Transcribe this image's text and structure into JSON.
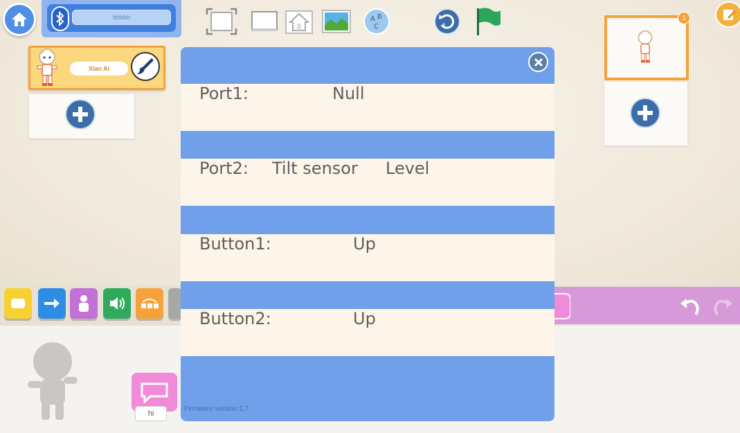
{
  "bluetooth": {
    "device_name": "bbbbb"
  },
  "sprite": {
    "name": "Xiao Ai"
  },
  "scene": {
    "badge": "1"
  },
  "script": {
    "speech_text": "hi"
  },
  "dialog": {
    "rows": [
      {
        "label": "Port1:",
        "value": "Null",
        "extra": ""
      },
      {
        "label": "Port2:",
        "value": "Tilt sensor",
        "extra": "Level"
      },
      {
        "label": "Button1:",
        "value": "Up",
        "extra": ""
      },
      {
        "label": "Button2:",
        "value": "Up",
        "extra": ""
      }
    ],
    "firmware": "Firmware version:1.7"
  },
  "colors": {
    "dialog_blue": "#6fa0e9",
    "row_cream": "#fdf5ea",
    "accent_orange": "#f3a23b",
    "bt_blue": "#3f7fe0"
  },
  "icons": [
    "home-icon",
    "bluetooth-icon",
    "fullscreen-icon",
    "window-icon",
    "house-outline-icon",
    "image-icon",
    "abc-icon",
    "reset-icon",
    "green-flag-icon",
    "edit-icon",
    "paint-brush-icon",
    "plus-icon",
    "close-icon",
    "undo-icon",
    "redo-icon"
  ]
}
